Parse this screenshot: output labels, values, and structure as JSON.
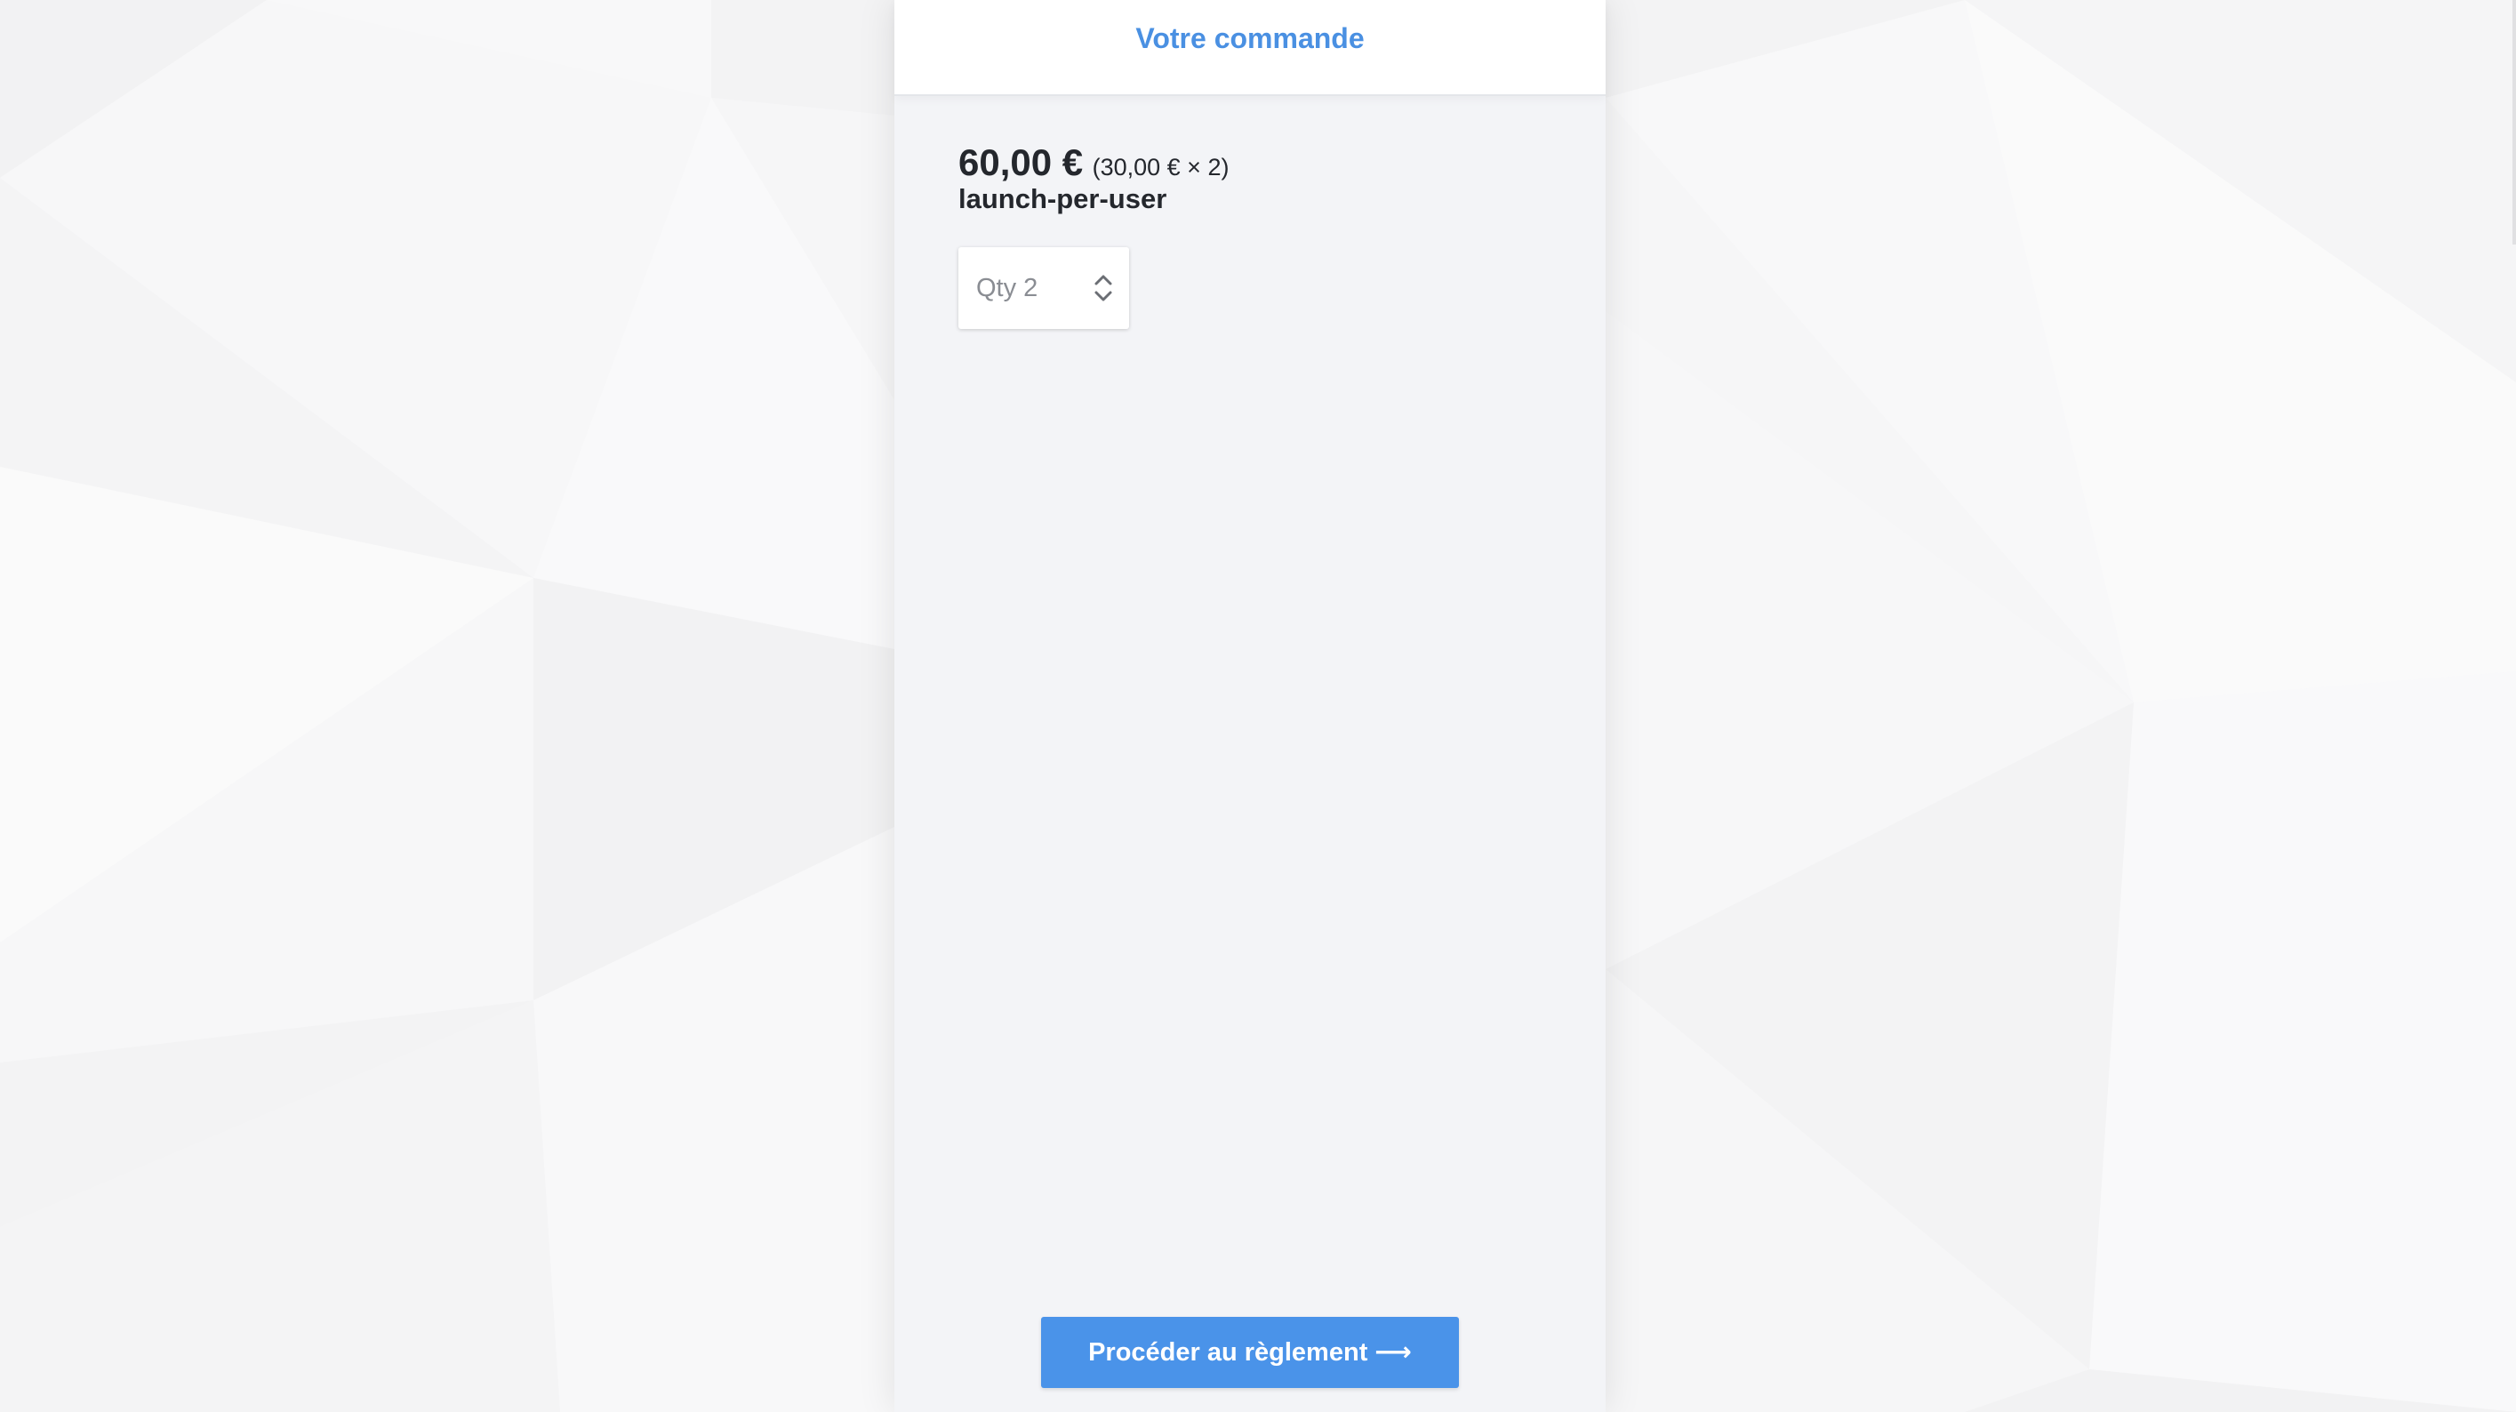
{
  "header": {
    "title": "Votre commande"
  },
  "order": {
    "total": "60,00 €",
    "breakdown": "(30,00 € × 2)",
    "product": "launch-per-user",
    "quantity_label": "Qty 2",
    "quantity": 2,
    "unit_price": "30,00 €"
  },
  "actions": {
    "checkout_label": "Procéder au règlement",
    "checkout_arrow": "⟶"
  },
  "icons": {
    "quantity_stepper": "chevron-up-down-icon",
    "checkout_arrow": "long-arrow-right-icon"
  },
  "colors": {
    "accent": "#4a90e2",
    "button": "#4a93e9",
    "panel_background": "#f3f4f7",
    "text": "#24272d"
  }
}
